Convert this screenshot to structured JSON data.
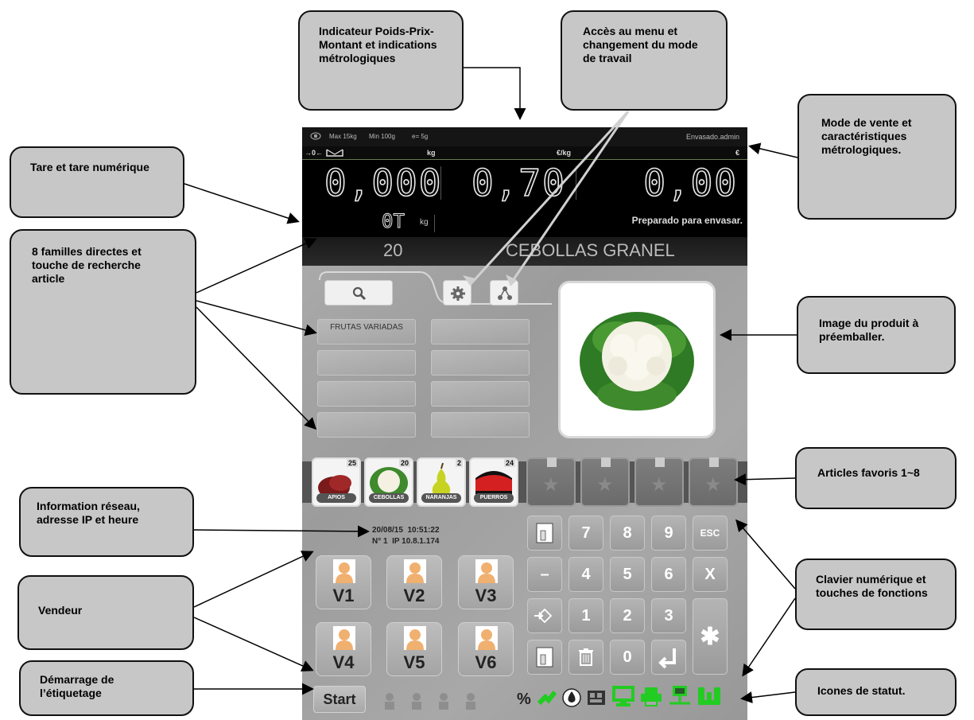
{
  "callouts": {
    "tare": "Tare et tare numérique",
    "indicator": "Indicateur Poids-Prix-Montant et indications métrologiques",
    "menu": "Accès au menu et changement du mode de travail",
    "mode": "Mode de vente et caractéristiques métrologiques.",
    "families": "8 familles directes et touche de recherche article",
    "image": "Image du produit à préemballer.",
    "favorites": "Articles favoris 1~8",
    "network": "Information réseau, adresse IP et heure",
    "keypad": "Clavier numérique et touches de fonctions",
    "seller": "Vendeur",
    "start": "Démarrage de l’étiquetage",
    "status": "Icones de statut."
  },
  "scale": {
    "max": "Max 15kg",
    "min": "Min 100g",
    "e": "e= 5g",
    "user": "Envasado.admin",
    "zero_indicator": "→0←",
    "unit_weight": "kg",
    "unit_price": "€/kg",
    "unit_amount": "€",
    "weight": "0,000",
    "price": "0,70",
    "amount": "0,00",
    "tare": "0T",
    "tare_unit": "kg",
    "status_msg": "Preparado para envasar.",
    "product_code": "20",
    "product_name": "CEBOLLAS GRANEL"
  },
  "families": [
    "FRUTAS VARIADAS",
    "",
    "",
    "",
    "",
    "",
    "",
    ""
  ],
  "favorites": [
    {
      "label": "APIOS",
      "count": "25"
    },
    {
      "label": "CEBOLLAS",
      "count": "20"
    },
    {
      "label": "NARANJAS",
      "count": "2"
    },
    {
      "label": "PUERROS",
      "count": "24"
    }
  ],
  "network": {
    "date": "20/08/15",
    "time": "10:51:22",
    "number": "N° 1",
    "ip": "IP 10.8.1.174"
  },
  "sellers": [
    "V1",
    "V2",
    "V3",
    "V4",
    "V5",
    "V6"
  ],
  "keypad": {
    "k7": "7",
    "k8": "8",
    "k9": "9",
    "esc": "ESC",
    "minus": "–",
    "k4": "4",
    "k5": "5",
    "k6": "6",
    "x": "X",
    "k1": "1",
    "k2": "2",
    "k3": "3",
    "k0": "0",
    "star": "✱"
  },
  "bottom": {
    "start": "Start",
    "percent": "%"
  },
  "colors": {
    "callout_bg": "#c7c7c7",
    "status_green": "#22cc22",
    "display_bg": "#000000"
  },
  "icons": [
    "search-icon",
    "gear-icon",
    "network-icon",
    "seller-person-icon",
    "trash-icon",
    "enter-icon",
    "drop-icon",
    "monitor-icon",
    "printer-icon"
  ]
}
